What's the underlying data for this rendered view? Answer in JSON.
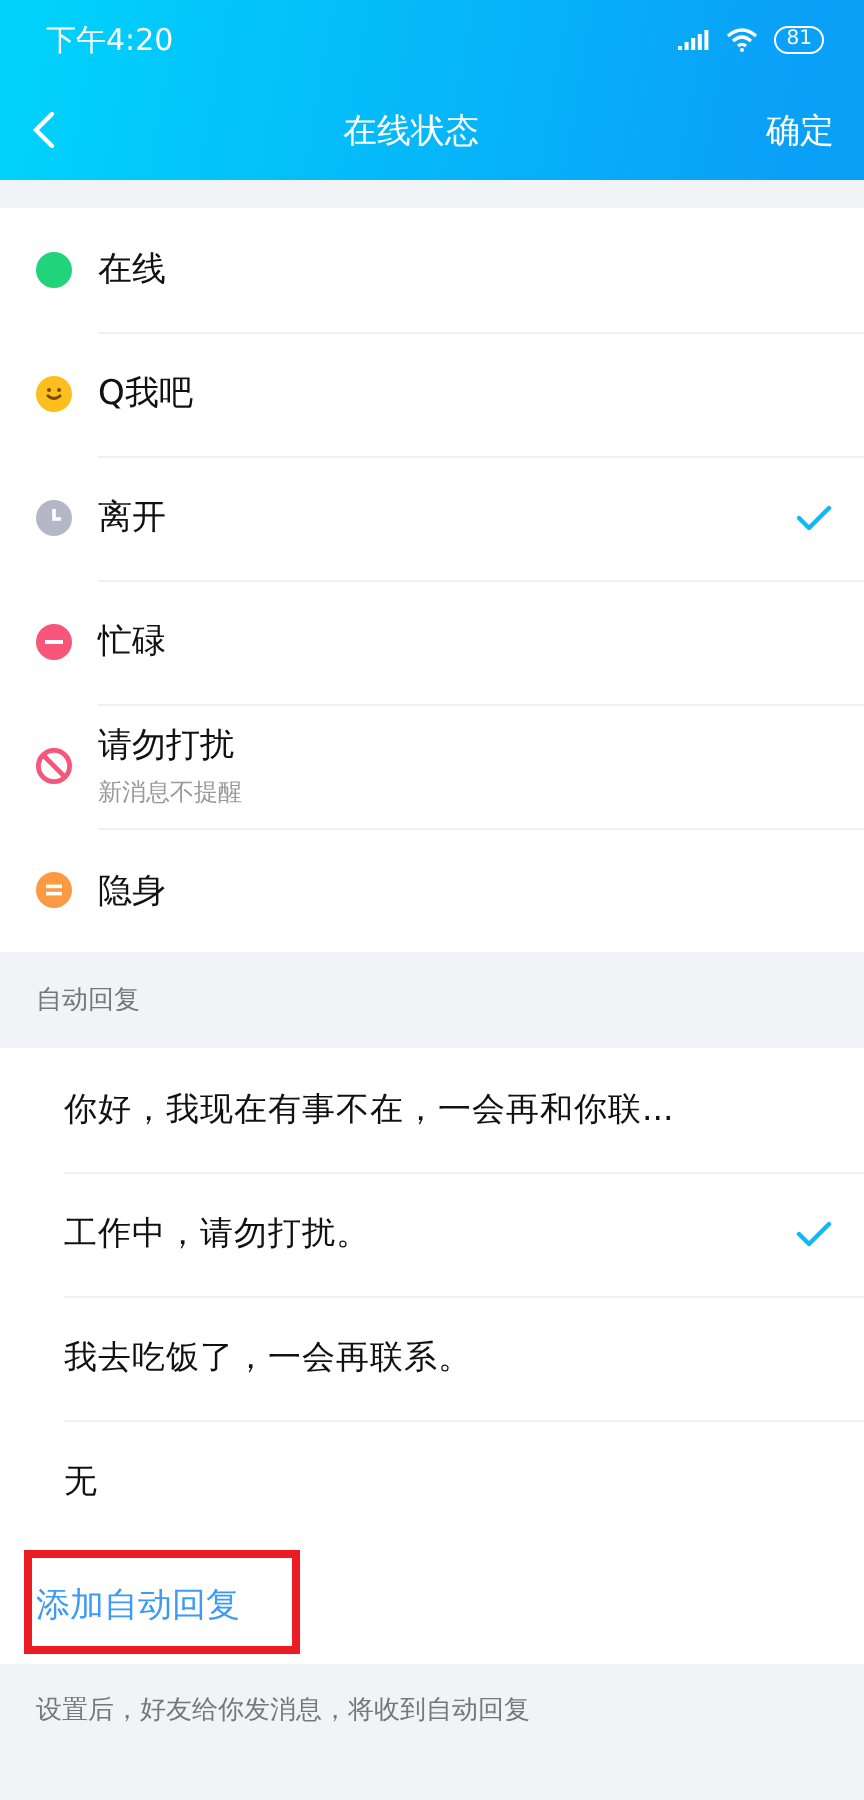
{
  "status_bar": {
    "time": "下午4:20",
    "battery": "81"
  },
  "nav": {
    "title": "在线状态",
    "action": "确定"
  },
  "statuses": [
    {
      "kind": "online",
      "label": "在线",
      "selected": false
    },
    {
      "kind": "qme",
      "label": "Q我吧",
      "selected": false
    },
    {
      "kind": "away",
      "label": "离开",
      "selected": true
    },
    {
      "kind": "busy",
      "label": "忙碌",
      "selected": false
    },
    {
      "kind": "dnd",
      "label": "请勿打扰",
      "sublabel": "新消息不提醒",
      "selected": false
    },
    {
      "kind": "invisible",
      "label": "隐身",
      "selected": false
    }
  ],
  "auto_reply": {
    "header": "自动回复",
    "replies": [
      {
        "label": "你好，我现在有事不在，一会再和你联...",
        "selected": false
      },
      {
        "label": "工作中，请勿打扰。",
        "selected": true
      },
      {
        "label": "我去吃饭了，一会再联系。",
        "selected": false
      },
      {
        "label": "无",
        "selected": false
      }
    ],
    "add": {
      "label": "添加自动回复",
      "highlighted": true
    },
    "footnote": "设置后，好友给你发消息，将收到自动回复"
  }
}
